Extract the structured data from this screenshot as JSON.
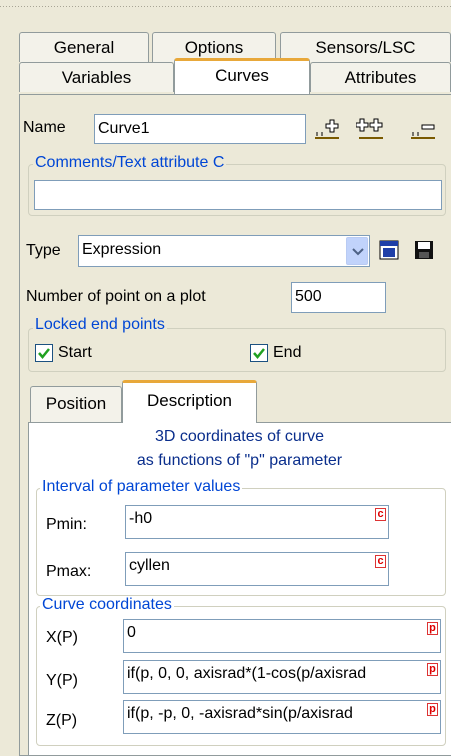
{
  "tabs_row1": [
    "General",
    "Options",
    "Sensors/LSC"
  ],
  "tabs_row2": [
    "Variables",
    "Curves",
    "Attributes"
  ],
  "name": {
    "label": "Name",
    "value": "Curve1"
  },
  "comments": {
    "legend": "Comments/Text attribute C",
    "value": ""
  },
  "type": {
    "label": "Type",
    "value": "Expression"
  },
  "points": {
    "label": "Number of point on a plot",
    "value": "500"
  },
  "locked": {
    "legend": "Locked end points",
    "start_label": "Start",
    "start_checked": true,
    "end_label": "End",
    "end_checked": true
  },
  "subtabs": [
    "Position",
    "Description"
  ],
  "description": {
    "heading_line1": "3D coordinates of curve",
    "heading_line2": "as functions of \"p\" parameter",
    "interval_legend": "Interval of parameter values",
    "pmin_label": "Pmin:",
    "pmin_value": "-h0",
    "pmin_tag": "c",
    "pmax_label": "Pmax:",
    "pmax_value": "cyllen",
    "pmax_tag": "c",
    "coords_legend": "Curve coordinates",
    "x_label": "X(P)",
    "x_value": "0",
    "x_tag": "p",
    "y_label": "Y(P)",
    "y_value": "if(p, 0, 0, axisrad*(1-cos(p/axisrad",
    "y_tag": "p",
    "z_label": "Z(P)",
    "z_value": "if(p, -p, 0, -axisrad*sin(p/axisrad",
    "z_tag": "p"
  },
  "icons": [
    "add-curve-icon",
    "add-multiple-curves-icon",
    "remove-curve-icon",
    "dropdown-arrow-icon",
    "window-icon",
    "save-icon"
  ],
  "colors": {
    "accent_tab": "#E8A83A",
    "legend_blue": "#0046D5",
    "tag_red": "#D00000",
    "check_green": "#21A121"
  }
}
